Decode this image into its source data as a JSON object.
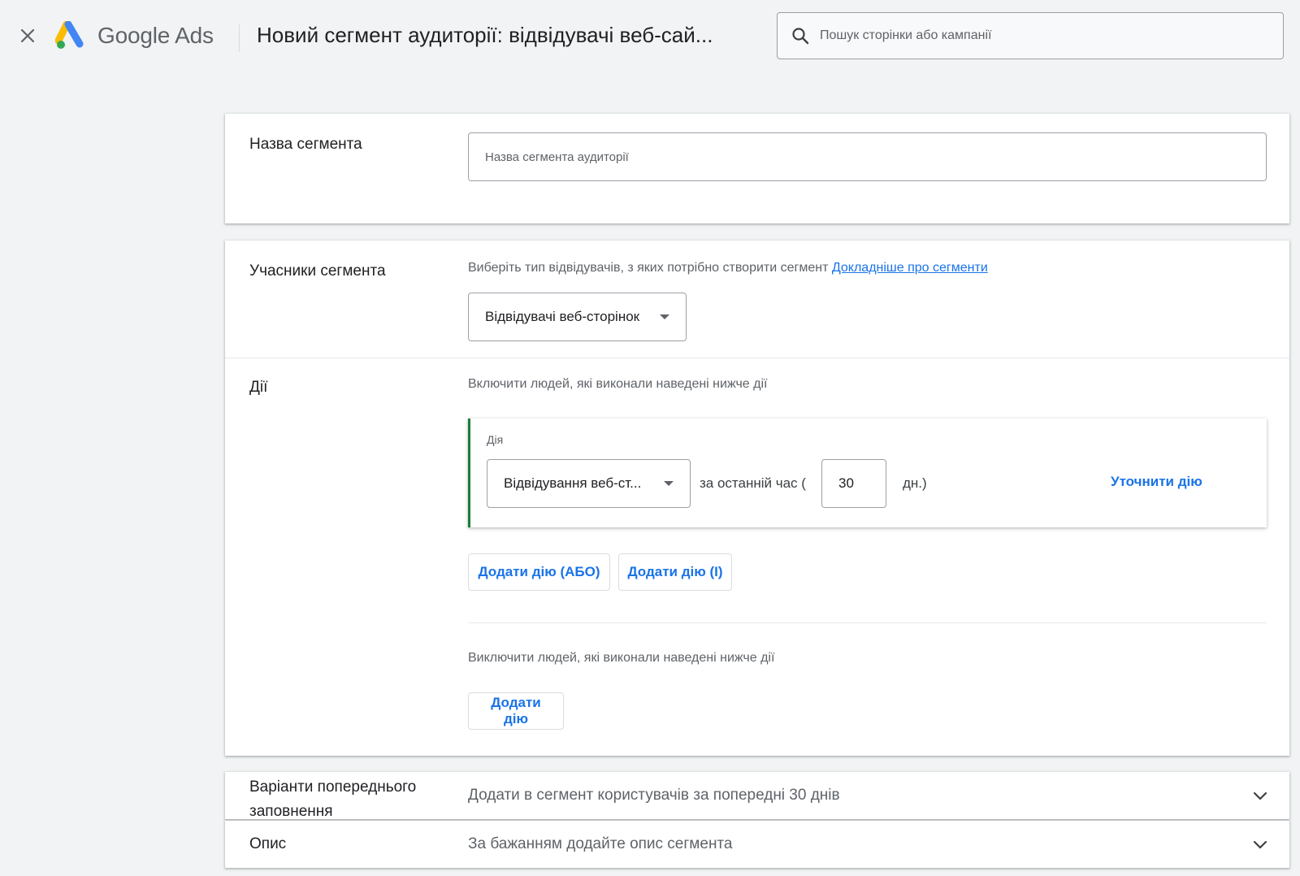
{
  "header": {
    "close_icon": "close-icon",
    "logo_text": "Google Ads",
    "page_title": "Новий сегмент аудиторії: відвідувачі веб-сай...",
    "search_placeholder": "Пошук сторінки або кампанії"
  },
  "segment_name": {
    "label": "Назва сегмента",
    "placeholder": "Назва сегмента аудиторії",
    "value": ""
  },
  "members": {
    "label": "Учасники сегмента",
    "helper": "Виберіть тип відвідувачів, з яких потрібно створити сегмент",
    "link": "Докладніше про сегменти",
    "selected": "Відвідувачі веб-сторінок"
  },
  "actions": {
    "label": "Дії",
    "include_text": "Включити людей, які виконали наведені нижче дії",
    "action_card": {
      "title": "Дія",
      "selected_action": "Відвідування веб-ст...",
      "period_prefix": "за останній час (",
      "days_value": "30",
      "period_suffix": "дн.)",
      "refine_label": "Уточнити дію"
    },
    "add_or_label": "Додати дію (АБО)",
    "add_and_label": "Додати дію (І)",
    "exclude_text": "Виключити людей, які виконали наведені нижче дії",
    "add_action_label": "Додати дію"
  },
  "prefill": {
    "label": "Варіанти попереднього заповнення",
    "summary": "Додати в сегмент користувачів за попередні 30 днів"
  },
  "description": {
    "label": "Опис",
    "summary": "За бажанням додайте опис сегмента"
  },
  "colors": {
    "accent_blue": "#1a73e8",
    "action_green": "#188038",
    "background": "#f1f3f4"
  }
}
